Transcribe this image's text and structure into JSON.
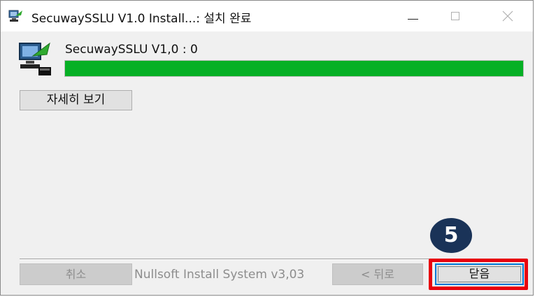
{
  "window": {
    "title": "SecuwaySSLU V1.0 Install...: 설치 완료",
    "minimize_symbol": "—",
    "maximize_symbol": "☐",
    "close_symbol": "✕"
  },
  "install": {
    "status_text": "SecuwaySSLU V1,0 : 0",
    "progress": 1.0,
    "progress_color": "#06b025"
  },
  "buttons": {
    "details": "자세히 보기",
    "cancel": "취소",
    "back": "< 뒤로",
    "close": "닫음"
  },
  "footer": {
    "brand": "Nullsoft Install System v3,03"
  },
  "annotation": {
    "step_number": "5",
    "highlight_color": "#e8000d",
    "badge_color": "#1a3358"
  }
}
